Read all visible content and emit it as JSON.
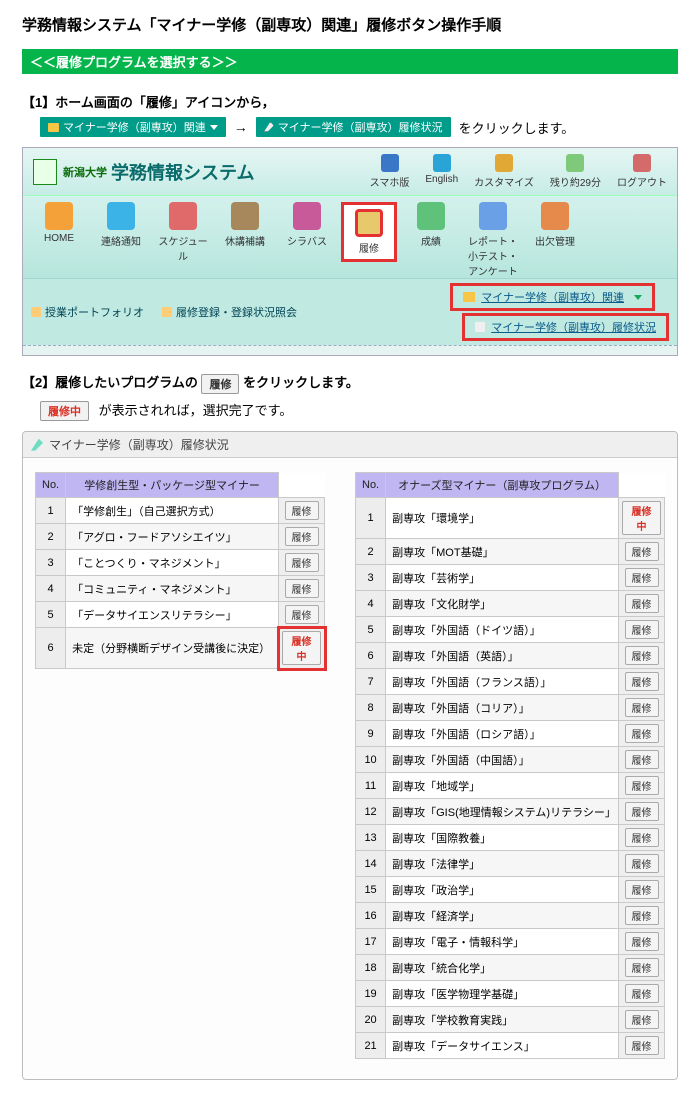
{
  "title": "学務情報システム「マイナー学修（副専攻）関連」履修ボタン操作手順",
  "section_header": "＜＜履修プログラムを選択する＞＞",
  "step1": {
    "label": "【1】ホーム画面の「履修」アイコンから，",
    "chip1": "マイナー学修（副専攻）関連",
    "arrow": "→",
    "chip2": "マイナー学修（副専攻）履修状況",
    "tail": "をクリックします。"
  },
  "sys": {
    "university": "新潟大学",
    "system_name": "学務情報システム",
    "top_tools": [
      {
        "label": "スマホ版",
        "color": "#3a78c7"
      },
      {
        "label": "English",
        "color": "#2aa3d6"
      },
      {
        "label": "カスタマイズ",
        "color": "#e2a836"
      },
      {
        "label": "残り約29分",
        "color": "#7ec97a"
      },
      {
        "label": "ログアウト",
        "color": "#d46a6a"
      }
    ],
    "nav": [
      {
        "label": "HOME",
        "color": "#f4a13a"
      },
      {
        "label": "連絡通知",
        "color": "#3bb3e6"
      },
      {
        "label": "スケジュール",
        "color": "#e06a6a"
      },
      {
        "label": "休講補講",
        "color": "#a6885c"
      },
      {
        "label": "シラバス",
        "color": "#c95a9a"
      },
      {
        "label": "履修",
        "color": "#e7c96b",
        "highlight": true
      },
      {
        "label": "成績",
        "color": "#5fc27a"
      },
      {
        "label": "レポート・小テスト・アンケート",
        "color": "#6aa0e6"
      },
      {
        "label": "出欠管理",
        "color": "#e58a4a"
      }
    ],
    "subbar": {
      "item1": "授業ポートフォリオ",
      "item2": "履修登録・登録状況照会",
      "drop1": "マイナー学修（副専攻）関連",
      "drop2": "マイナー学修（副専攻）履修状況"
    }
  },
  "step2": {
    "label_a": "【2】履修したいプログラムの",
    "btn": "履修",
    "label_b": "をクリックします。",
    "line2_btn": "履修中",
    "line2_tail": "が表示されれば，選択完了です。",
    "panel_title": "マイナー学修（副専攻）履修状況",
    "left_header": "学修創生型・パッケージ型マイナー",
    "right_header": "オナーズ型マイナー（副専攻プログラム）",
    "no_header": "No.",
    "btn_label": "履修",
    "btn_active": "履修中",
    "left_rows": [
      {
        "no": "1",
        "name": "「学修創生」（自己選択方式）",
        "state": "normal"
      },
      {
        "no": "2",
        "name": "「アグロ・フードアソシエイツ」",
        "state": "normal"
      },
      {
        "no": "3",
        "name": "「ことつくり・マネジメント」",
        "state": "normal"
      },
      {
        "no": "4",
        "name": "「コミュニティ・マネジメント」",
        "state": "normal"
      },
      {
        "no": "5",
        "name": "「データサイエンスリテラシー」",
        "state": "normal"
      },
      {
        "no": "6",
        "name": "未定（分野横断デザイン受講後に決定）",
        "state": "active"
      }
    ],
    "right_rows": [
      {
        "no": "1",
        "name": "副専攻「環境学」",
        "state": "active"
      },
      {
        "no": "2",
        "name": "副専攻「MOT基礎」",
        "state": "normal"
      },
      {
        "no": "3",
        "name": "副専攻「芸術学」",
        "state": "normal"
      },
      {
        "no": "4",
        "name": "副専攻「文化財学」",
        "state": "normal"
      },
      {
        "no": "5",
        "name": "副専攻「外国語（ドイツ語）」",
        "state": "normal"
      },
      {
        "no": "6",
        "name": "副専攻「外国語（英語）」",
        "state": "normal"
      },
      {
        "no": "7",
        "name": "副専攻「外国語（フランス語）」",
        "state": "normal"
      },
      {
        "no": "8",
        "name": "副専攻「外国語（コリア）」",
        "state": "normal"
      },
      {
        "no": "9",
        "name": "副専攻「外国語（ロシア語）」",
        "state": "normal"
      },
      {
        "no": "10",
        "name": "副専攻「外国語（中国語）」",
        "state": "normal"
      },
      {
        "no": "11",
        "name": "副専攻「地域学」",
        "state": "normal"
      },
      {
        "no": "12",
        "name": "副専攻「GIS(地理情報システム)リテラシー」",
        "state": "normal"
      },
      {
        "no": "13",
        "name": "副専攻「国際教養」",
        "state": "normal"
      },
      {
        "no": "14",
        "name": "副専攻「法律学」",
        "state": "normal"
      },
      {
        "no": "15",
        "name": "副専攻「政治学」",
        "state": "normal"
      },
      {
        "no": "16",
        "name": "副専攻「経済学」",
        "state": "normal"
      },
      {
        "no": "17",
        "name": "副専攻「電子・情報科学」",
        "state": "normal"
      },
      {
        "no": "18",
        "name": "副専攻「統合化学」",
        "state": "normal"
      },
      {
        "no": "19",
        "name": "副専攻「医学物理学基礎」",
        "state": "normal"
      },
      {
        "no": "20",
        "name": "副専攻「学校教育実践」",
        "state": "normal"
      },
      {
        "no": "21",
        "name": "副専攻「データサイエンス」",
        "state": "normal"
      }
    ]
  }
}
